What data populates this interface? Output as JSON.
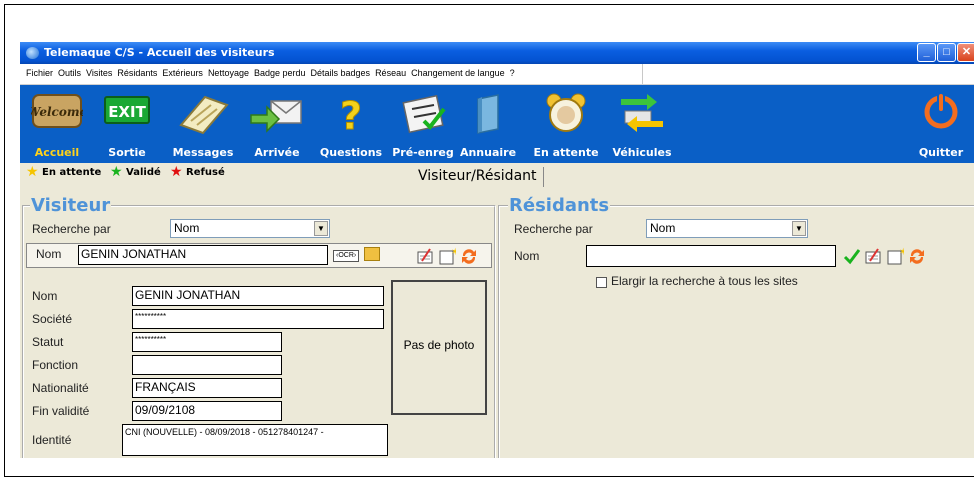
{
  "window": {
    "title": "Telemaque C/S  - Accueil des visiteurs"
  },
  "menu": [
    "Fichier",
    "Outils",
    "Visites",
    "Résidants",
    "Extérieurs",
    "Nettoyage",
    "Badge perdu",
    "Détails badges",
    "Réseau",
    "Changement de langue",
    "?"
  ],
  "toolbar": {
    "accueil": "Accueil",
    "sortie": "Sortie",
    "messages": "Messages",
    "arrivee": "Arrivée",
    "questions": "Questions",
    "preenreg": "Pré-enreg",
    "annuaire": "Annuaire",
    "attente": "En attente",
    "vehicules": "Véhicules",
    "quitter": "Quitter",
    "welcome_text": "Welcome",
    "exit_text": "EXIT"
  },
  "legend": {
    "attente": "En attente",
    "valide": "Validé",
    "refuse": "Refusé",
    "colors": {
      "attente": "#f5c400",
      "valide": "#19b31e",
      "refuse": "#e01010"
    }
  },
  "tab": "Visiteur/Résidant",
  "visiteur": {
    "title": "Visiteur",
    "search_label": "Recherche par",
    "search_by": "Nom",
    "name_label": "Nom",
    "name_value": "GENIN JONATHAN",
    "ocr": "‹OCR›",
    "fields": {
      "nom_label": "Nom",
      "nom": "GENIN JONATHAN",
      "societe_label": "Société",
      "societe": "**********",
      "statut_label": "Statut",
      "statut": "**********",
      "fonction_label": "Fonction",
      "fonction": "",
      "nationalite_label": "Nationalité",
      "nationalite": "FRANÇAIS",
      "finvalidite_label": "Fin validité",
      "finvalidite": "09/09/2108",
      "identite_label": "Identité",
      "identite": "CNI (NOUVELLE) - 08/09/2018 - 051278401247 -"
    },
    "photo": "Pas de photo"
  },
  "residants": {
    "title": "Résidants",
    "search_label": "Recherche par",
    "search_by": "Nom",
    "name_label": "Nom",
    "name_value": "",
    "widen_label": "Elargir la recherche à tous les sites"
  },
  "theme": {
    "toolbar_bg": "#0a5fc6",
    "title_accent": "#4f93d8",
    "active_label": "#ffd21a"
  }
}
